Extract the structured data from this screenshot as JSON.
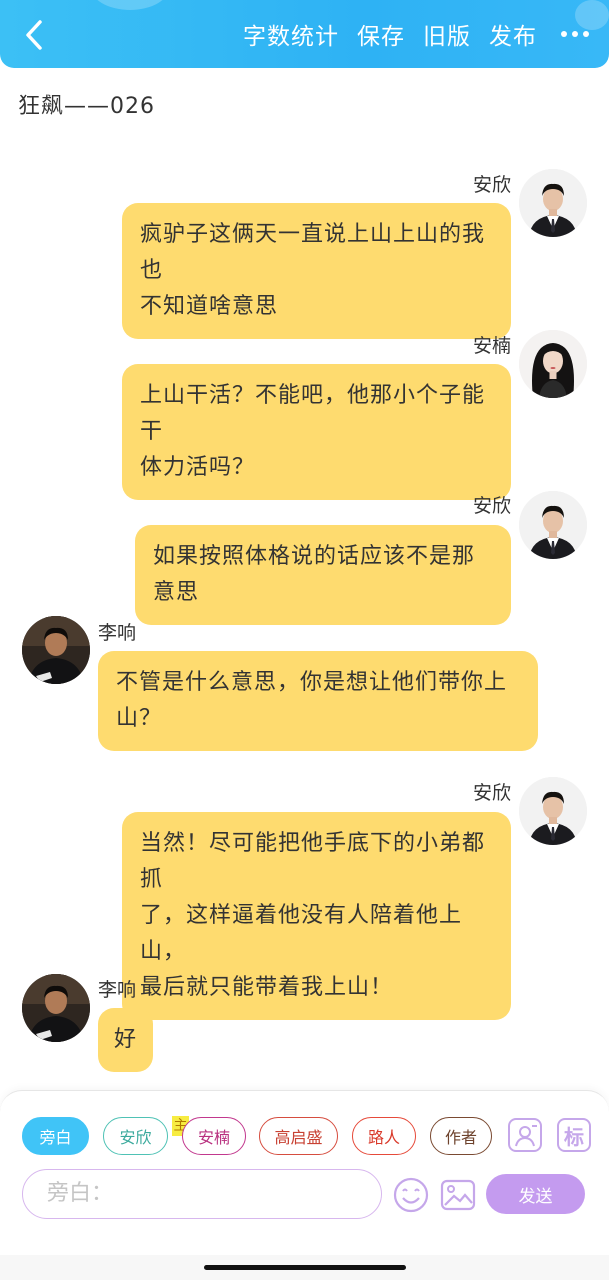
{
  "header": {
    "actions": [
      "字数统计",
      "保存",
      "旧版",
      "发布"
    ]
  },
  "story": {
    "title": "狂飙——026"
  },
  "messages": [
    {
      "speaker": "安欣",
      "text_lines": [
        "疯驴子这俩天一直说上山上山的我也",
        "不知道啥意思"
      ]
    },
    {
      "speaker": "安楠",
      "text_lines": [
        "上山干活？不能吧，他那小个子能干",
        "体力活吗？"
      ]
    },
    {
      "speaker": "安欣",
      "text_lines": [
        "如果按照体格说的话应该不是那意思"
      ]
    },
    {
      "speaker": "李响",
      "text_lines": [
        "不管是什么意思，你是想让他们带你上",
        "山？"
      ]
    },
    {
      "speaker": "安欣",
      "text_lines": [
        "当然！尽可能把他手底下的小弟都抓",
        "了，这样逼着他没有人陪着他上山，",
        "最后就只能带着我上山！"
      ]
    },
    {
      "speaker": "李响",
      "text_lines": [
        "好"
      ]
    }
  ],
  "composer": {
    "roles": [
      "旁白",
      "安欣",
      "安楠",
      "高启盛",
      "路人",
      "作者"
    ],
    "main_tag": "主",
    "tag_icon_label": "标",
    "input_placeholder": "旁白：",
    "send_label": "发送"
  },
  "colors": {
    "header": "#2eb2f4",
    "bubble": "#fedb6f",
    "accent_purple": "#c49bef",
    "narration_active": "#40c4f7"
  }
}
